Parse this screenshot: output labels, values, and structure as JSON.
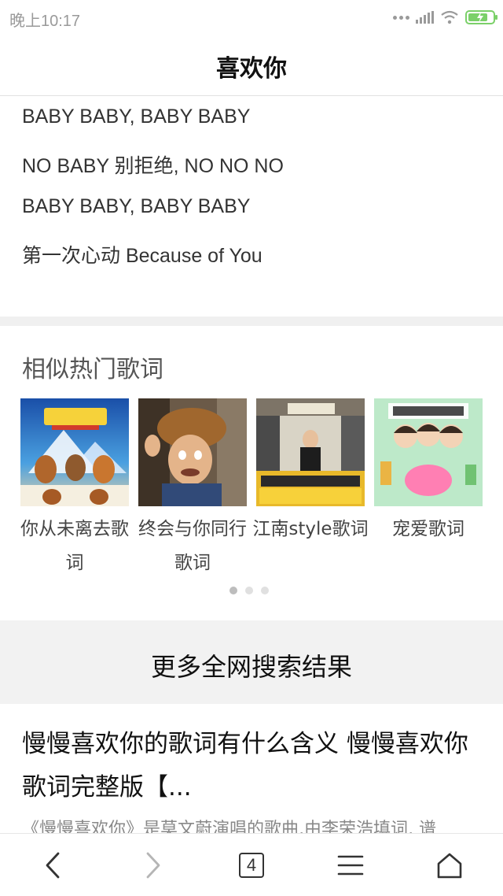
{
  "status_bar": {
    "time": "晚上10:17",
    "icons": [
      "more-dots-icon",
      "signal-icon",
      "wifi-icon",
      "battery-charging-icon"
    ]
  },
  "header": {
    "title": "喜欢你"
  },
  "lyrics": {
    "lines": [
      "BABY BABY, BABY BABY",
      "NO BABY 别拒绝, NO NO NO",
      "BABY BABY, BABY BABY",
      "第一次心动 Because of You"
    ]
  },
  "similar": {
    "title": "相似热门歌词",
    "items": [
      {
        "title": "你从未离去歌词"
      },
      {
        "title": "终会与你同行歌词"
      },
      {
        "title": "江南style歌词"
      },
      {
        "title": "宠爱歌词"
      }
    ],
    "pager": {
      "total": 3,
      "active": 1
    }
  },
  "more_results": {
    "label": "更多全网搜索结果"
  },
  "result": {
    "title": "慢慢喜欢你的歌词有什么含义 慢慢喜欢你歌词完整版【...",
    "snippet": "《慢慢喜欢你》是莫文蔚演唱的歌曲,由李荣浩填词, 谱"
  },
  "bottom_nav": {
    "tab_count": "4",
    "icons": [
      "back-icon",
      "forward-icon",
      "tabs-icon",
      "menu-icon",
      "home-icon"
    ]
  },
  "colors": {
    "accent_battery": "#7bd069",
    "divider": "#f0f0f0",
    "text_primary": "#111111",
    "text_secondary": "#888888"
  }
}
